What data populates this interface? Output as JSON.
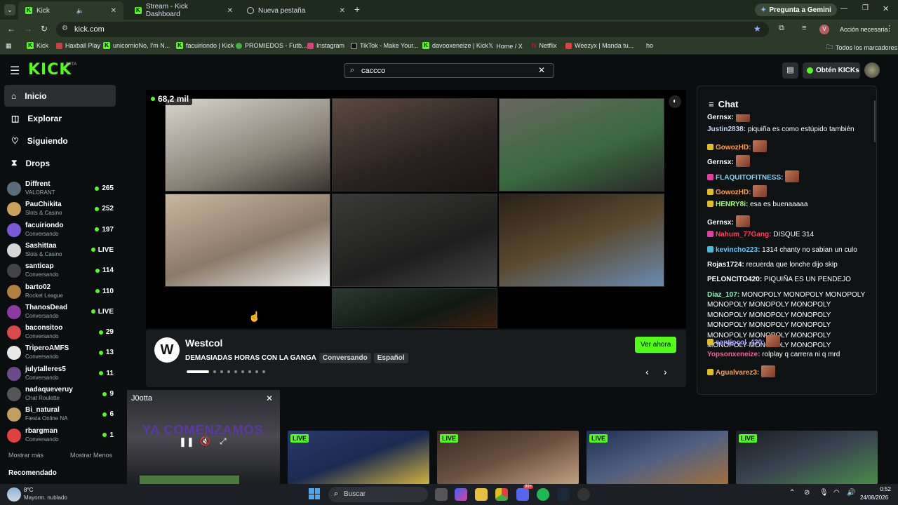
{
  "browser": {
    "tabs": [
      {
        "title": "Kick",
        "active": true
      },
      {
        "title": "Stream - Kick Dashboard"
      },
      {
        "title": "Nueva pestaña"
      }
    ],
    "new_tab": "+",
    "gemini": "Pregunta a Gemini",
    "url": "kick.com",
    "profile_initial": "V",
    "action": "Acción necesaria",
    "bookmarks": [
      "Kick",
      "Haxball Play",
      "unicornioNo, I'm N...",
      "facuiriondo | Kick",
      "PROMIEDOS - Futb...",
      "Instagram",
      "TikTok - Make Your...",
      "davooxeneize | Kick",
      "Home / X",
      "Netflix",
      "Weezyx | Manda tu...",
      "ho"
    ],
    "all_bookmarks": "Todos los marcadores"
  },
  "site": {
    "logo": "KICK",
    "logo_beta": "BETA",
    "search_value": "caccco",
    "get_kicks": "Obtén KICKs"
  },
  "sidebar": {
    "nav": [
      {
        "label": "Inicio",
        "icon": "home-icon"
      },
      {
        "label": "Explorar",
        "icon": "explore-icon"
      },
      {
        "label": "Siguiendo",
        "icon": "heart-icon"
      },
      {
        "label": "Drops",
        "icon": "drops-icon"
      }
    ],
    "channels": [
      {
        "name": "Diffrent",
        "category": "VALORANT",
        "viewers": "265",
        "color": "#5a6b7c"
      },
      {
        "name": "PauChikita",
        "category": "Slots & Casino",
        "viewers": "252",
        "color": "#c9a15a"
      },
      {
        "name": "facuiriondo",
        "category": "Conversando",
        "viewers": "197",
        "color": "#7a5ad9"
      },
      {
        "name": "Sashittaa",
        "category": "Slots & Casino",
        "viewers": "LIVE",
        "color": "#d6d6d6"
      },
      {
        "name": "santicap",
        "category": "Conversando",
        "viewers": "114",
        "color": "#444"
      },
      {
        "name": "barto02",
        "category": "Rocket League",
        "viewers": "110",
        "color": "#b08040"
      },
      {
        "name": "ThanosDead",
        "category": "Conversando",
        "viewers": "LIVE",
        "color": "#8a3aa0"
      },
      {
        "name": "baconsitoo",
        "category": "Conversando",
        "viewers": "29",
        "color": "#d84a4a"
      },
      {
        "name": "TriperoAMFS",
        "category": "Conversando",
        "viewers": "13",
        "color": "#e8e8e8"
      },
      {
        "name": "julytalleres5",
        "category": "Conversando",
        "viewers": "11",
        "color": "#6a4a8a"
      },
      {
        "name": "nadaqueveruy",
        "category": "Chat Roulette",
        "viewers": "9",
        "color": "#555"
      },
      {
        "name": "Bi_natural",
        "category": "Fiesta Online NA",
        "viewers": "6",
        "color": "#c0a060"
      },
      {
        "name": "rbargman",
        "category": "Conversando",
        "viewers": "1",
        "color": "#e04040"
      }
    ],
    "show_more": "Mostrar más",
    "show_less": "Mostrar Menos",
    "recommended": "Recomendado"
  },
  "player": {
    "viewers": "68,2 mil"
  },
  "featured": {
    "channel": "Westcol",
    "title": "DEMASIADAS HORAS CON LA GANGA",
    "tags": [
      "Conversando",
      "Español"
    ],
    "watch": "Ver ahora"
  },
  "chat": {
    "title": "Chat",
    "messages": [
      {
        "user": "Gernsx",
        "color": "#ffffff",
        "text": "",
        "emote": true,
        "badge": ""
      },
      {
        "user": "Justin2838",
        "color": "#c8d6f0",
        "text": "piquiña es como estúpido también",
        "emote": false,
        "badge": ""
      },
      {
        "user": "GowozHD",
        "color": "#ff9f40",
        "text": "",
        "emote": true,
        "badge": "#e0c020"
      },
      {
        "user": "Gernsx",
        "color": "#ffffff",
        "text": "",
        "emote": true,
        "badge": ""
      },
      {
        "user": "FLAQUITOFITNESS",
        "color": "#7fd6ff",
        "text": "",
        "emote": true,
        "badge": "#e040a0"
      },
      {
        "user": "GowozHD",
        "color": "#ff9f40",
        "text": "",
        "emote": true,
        "badge": "#e0c020"
      },
      {
        "user": "HENRY8i",
        "color": "#a0ff60",
        "text": "esa es buenaaaaa",
        "emote": false,
        "badge": "#e0c020"
      },
      {
        "user": "Gernsx",
        "color": "#ffffff",
        "text": "",
        "emote": true,
        "badge": ""
      },
      {
        "user": "Nahum_77Gang",
        "color": "#ff4060",
        "text": "DISQUE 314",
        "emote": false,
        "badge": "#e040a0"
      },
      {
        "user": "kevincho223",
        "color": "#60c8ff",
        "text": "1314 chanty no sabian un culo",
        "emote": false,
        "badge": "#40c0e0"
      },
      {
        "user": "Rojas1724",
        "color": "#ffffff",
        "text": "recuerda que lonche dijo skip",
        "emote": false,
        "badge": ""
      },
      {
        "user": "PELONCITO420",
        "color": "#ffffff",
        "text": "PIQUIÑA ES UN PENDEJO",
        "emote": false,
        "badge": ""
      },
      {
        "user": "Diaz_107",
        "color": "#8ff0c0",
        "text": "MONOPOLY MONOPOLY MONOPOLY MONOPOLY MONOPOLY MONOPOLY MONOPOLY MONOPOLY MONOPOLY MONOPOLY MONOPOLY MONOPOLY MONOPOLY MONOPOLY MONOPOLY MONOPOLY MONOPOLY MONOPOLY",
        "emote": false,
        "badge": ""
      },
      {
        "user": "santipcol_420",
        "color": "#a0a0ff",
        "text": "",
        "emote": true,
        "badge": "#e0c020"
      },
      {
        "user": "Yopsonxeneize",
        "color": "#ff5a9a",
        "text": "rolplay q carrera ni q mrd",
        "emote": false,
        "badge": ""
      },
      {
        "user": "Agualvarez3",
        "color": "#ff9f40",
        "text": "",
        "emote": true,
        "badge": "#e0c020"
      }
    ]
  },
  "mini": {
    "channel": "J0otta",
    "overlay": "YA COMENZAMOS"
  },
  "thumbs": [
    {
      "live": "LIVE"
    },
    {
      "live": "LIVE"
    },
    {
      "live": "LIVE"
    },
    {
      "live": "LIVE"
    }
  ],
  "taskbar": {
    "weather_temp": "8°C",
    "weather_desc": "Mayorm. nublado",
    "search": "Buscar",
    "time": "0:52",
    "date": "24/08/2026",
    "badge": "99+"
  },
  "colors": {
    "accent": "#53fc18",
    "bg": "#0b0e0f"
  }
}
